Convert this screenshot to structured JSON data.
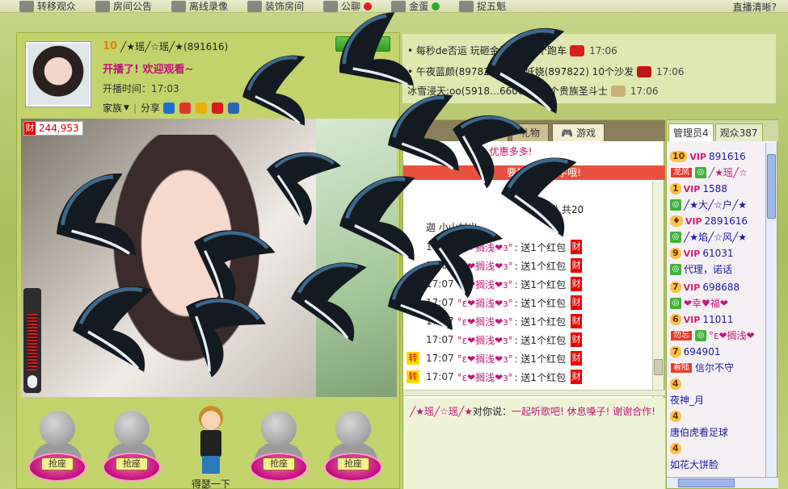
{
  "topbar": {
    "items": [
      {
        "label": "转移观众",
        "icon": "transfer-icon"
      },
      {
        "label": "房间公告",
        "icon": "tower-icon"
      },
      {
        "label": "离线录像",
        "icon": "video-icon"
      },
      {
        "label": "装饰房间",
        "icon": "decorate-icon"
      },
      {
        "label": "公聊",
        "icon": "chat-icon"
      },
      {
        "label": "金蛋",
        "icon": "location-icon"
      },
      {
        "label": "捉五魁",
        "icon": "hat-icon"
      }
    ],
    "right_label": "直播清晰?"
  },
  "host": {
    "level": "10",
    "name": "╱★瑶╱☆瑶╱★",
    "id": "891616",
    "follow_label": "+关注",
    "live_message": "开播了! 欢迎观看~",
    "start_time": "开播时间：17:03",
    "family_label": "家族",
    "share_label": "分享"
  },
  "video": {
    "money": "244,953",
    "money_badge": "财"
  },
  "seats": [
    {
      "label": "抢座"
    },
    {
      "label": "抢座"
    },
    {
      "label": "抢座"
    },
    {
      "label": "抢座"
    }
  ],
  "host_figure_label": "得瑟一下",
  "notices": [
    {
      "text": "• 每秒de否运 玩砸金蛋获得 1个跑车",
      "time": "17:06"
    },
    {
      "text": "• 午夜蓝颜(8978221)…魅妖娆(897822) 10个沙发",
      "time": "17:06"
    },
    {
      "text": "冰雪浸天:oo(5918…660009) 1个贵族圣斗士",
      "time": "17:06"
    }
  ],
  "chat": {
    "tabs": [
      "点歌",
      "礼物",
      "游戏"
    ],
    "tip": "下! 优惠多多!",
    "warn": "要超过10个字哦!",
    "partial_lines": [
      "瞅,共20",
      "迦 小山村出"
    ],
    "lines": [
      {
        "badge": "",
        "time": "17:07",
        "user": "°ε❤搁浅❤з°",
        "msg": ": 送1个红包"
      },
      {
        "badge": "",
        "time": "17:07",
        "user": "°ε❤搁浅❤з°",
        "msg": ": 送1个红包"
      },
      {
        "badge": "",
        "time": "17:07",
        "user": "°ε❤搁浅❤з°",
        "msg": ": 送1个红包"
      },
      {
        "badge": "",
        "time": "17:07",
        "user": "°ε❤搁浅❤з°",
        "msg": ": 送1个红包"
      },
      {
        "badge": "",
        "time": "17:07",
        "user": "°ε❤搁浅❤з°",
        "msg": ": 送1个红包"
      },
      {
        "badge": "",
        "time": "17:07",
        "user": "°ε❤搁浅❤з°",
        "msg": ": 送1个红包"
      },
      {
        "badge": "转",
        "time": "17:07",
        "user": "°ε❤搁浅❤з°",
        "msg": ": 送1个红包"
      },
      {
        "badge": "转",
        "time": "17:07",
        "user": "°ε❤搁浅❤з°",
        "msg": ": 送1个红包"
      }
    ],
    "cai_badge": "财",
    "private_user": "╱★瑶╱☆瑶╱★",
    "private_said": "对你说：",
    "private_msg": "一起听歌吧! 休息嗓子! 谢谢合作!"
  },
  "users": {
    "tabs": [
      "管理员4",
      "观众387"
    ],
    "rows": [
      {
        "level": "10",
        "vip": "VIP",
        "id": "891616",
        "tag": "龙凤",
        "name": "╱★瑶╱☆"
      },
      {
        "level": "1",
        "vip": "VIP",
        "id": "1588",
        "tag": "",
        "name": "╱★大╱☆户╱★"
      },
      {
        "level": "",
        "vip": "VIP",
        "id": "2891616",
        "tag": "",
        "name": "╱★焰╱☆风╱★"
      },
      {
        "level": "9",
        "vip": "VIP",
        "id": "61031",
        "tag": "",
        "name": "代理，诺话"
      },
      {
        "level": "7",
        "vip": "VIP",
        "id": "698688",
        "tag": "",
        "name": "❤幸♥福❤"
      },
      {
        "level": "6",
        "vip": "VIP",
        "id": "11011",
        "tag": "勿忘",
        "name": "°ε❤搁浅❤"
      },
      {
        "level": "7",
        "vip": "",
        "id": "694901",
        "tag": "着陆",
        "name": "信尔不守"
      },
      {
        "level": "4",
        "vip": "",
        "id": "",
        "tag": "",
        "name": "夜神_月"
      },
      {
        "level": "4",
        "vip": "",
        "id": "",
        "tag": "",
        "name": "唐伯虎看足球"
      },
      {
        "level": "4",
        "vip": "",
        "id": "",
        "tag": "",
        "name": "如花大饼脸"
      }
    ]
  },
  "colors": {
    "accent_pink": "#c01878",
    "follow_green": "#2e9a24",
    "warn_red": "#e8513f"
  }
}
